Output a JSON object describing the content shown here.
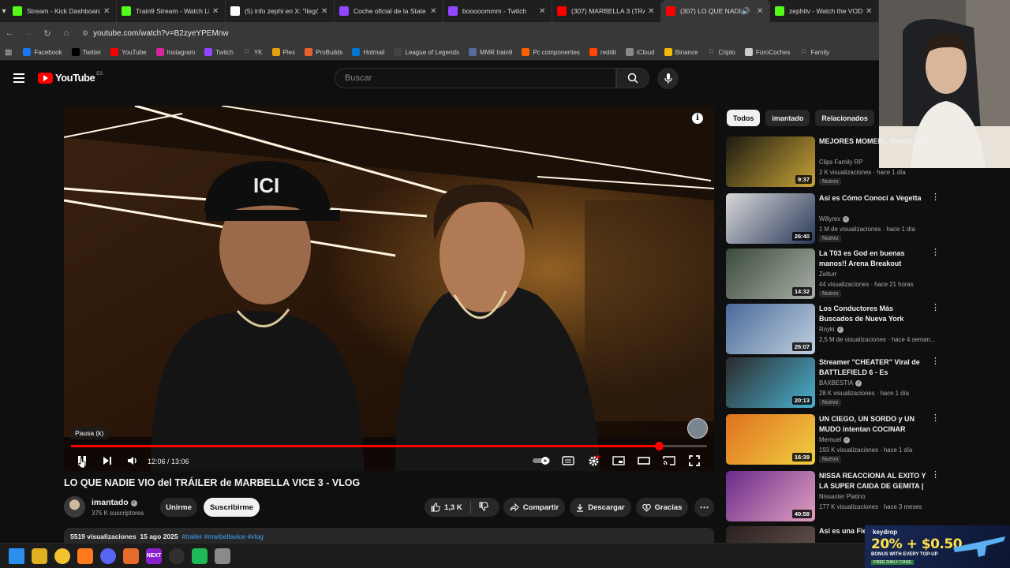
{
  "browser": {
    "tabs": [
      {
        "title": "Stream - Kick Dashboard",
        "favicon": "kick-icon",
        "color": "#53fc18"
      },
      {
        "title": "Train9 Stream - Watch Li...",
        "favicon": "kick-icon",
        "color": "#53fc18"
      },
      {
        "title": "(5) info zephi en X: \"llegó...",
        "favicon": "x-icon",
        "color": "#ffffff"
      },
      {
        "title": "Coche oficial de la State P...",
        "favicon": "twitch-icon",
        "color": "#9146ff"
      },
      {
        "title": "booooommm - Twitch",
        "favicon": "twitch-icon",
        "color": "#9146ff"
      },
      {
        "title": "(307) MARBELLA 3 (TRAI...",
        "favicon": "youtube-icon",
        "color": "#ff0000"
      },
      {
        "title": "(307) LO QUE NADIE",
        "favicon": "youtube-icon",
        "color": "#ff0000",
        "active": true
      },
      {
        "title": "zephitv - Watch the VOD",
        "favicon": "kick-icon",
        "color": "#53fc18"
      }
    ],
    "url": "youtube.com/watch?v=B2zyeYPEMnw",
    "bookmarks": [
      {
        "label": "Facebook",
        "icon": "facebook-icon",
        "color": "#1877f2"
      },
      {
        "label": "Twitter",
        "icon": "x-icon",
        "color": "#000000"
      },
      {
        "label": "YouTube",
        "icon": "youtube-icon",
        "color": "#ff0000"
      },
      {
        "label": "Instagram",
        "icon": "instagram-icon",
        "color": "#d6249f"
      },
      {
        "label": "Twitch",
        "icon": "twitch-icon",
        "color": "#9146ff"
      },
      {
        "label": "YK",
        "icon": "folder-icon",
        "color": "#383838"
      },
      {
        "label": "Plex",
        "icon": "plex-icon",
        "color": "#e5a00d"
      },
      {
        "label": "ProBuilds",
        "icon": "probuilds-icon",
        "color": "#e8612c"
      },
      {
        "label": "Hotmail",
        "icon": "outlook-icon",
        "color": "#0078d4"
      },
      {
        "label": "League of Legends",
        "icon": "lol-icon",
        "color": "#444444"
      },
      {
        "label": "MMR train9",
        "icon": "mmr-icon",
        "color": "#5a6a9a"
      },
      {
        "label": "Pc componentes",
        "icon": "pccomponentes-icon",
        "color": "#ff6000"
      },
      {
        "label": "reddit",
        "icon": "reddit-icon",
        "color": "#ff4500"
      },
      {
        "label": "iCloud",
        "icon": "apple-icon",
        "color": "#888888"
      },
      {
        "label": "Binance",
        "icon": "binance-icon",
        "color": "#f0b90b"
      },
      {
        "label": "Cripto",
        "icon": "folder-icon",
        "color": "#383838"
      },
      {
        "label": "ForoCoches",
        "icon": "forocoches-icon",
        "color": "#cccccc"
      },
      {
        "label": "Family",
        "icon": "folder-icon",
        "color": "#383838"
      }
    ]
  },
  "youtube": {
    "logo_word": "YouTube",
    "country": "ES",
    "search_placeholder": "Buscar"
  },
  "player": {
    "tooltip": "Pausa (k)",
    "time_display": "12:06 / 13:06",
    "progress": 0.9237
  },
  "video": {
    "title": "LO QUE NADIE VIO del TRÁILER de MARBELLA VICE 3 - VLOG",
    "channel": "imantado",
    "subscribers": "375 K suscriptores",
    "join_label": "Unirme",
    "subscribe_label": "Suscribirme",
    "likes": "1,3 K",
    "share_label": "Compartir",
    "download_label": "Descargar",
    "thanks_label": "Gracias",
    "views": "5519 visualizaciones",
    "date": "15 ago 2025",
    "tags": "#trailer #marbellavice #vlog"
  },
  "sidebar": {
    "chips": [
      "Todos",
      "imantado",
      "Relacionados"
    ],
    "recommendations": [
      {
        "title": "MEJORES MOMEN... Family RP",
        "channel": "Clips Family RP",
        "meta": "2 K visualizaciones · hace 1 día",
        "badge": "Nuevo",
        "duration": "9:37",
        "verified": false,
        "thumb": [
          "#1a1a10",
          "#c9a338"
        ]
      },
      {
        "title": "Así es Cómo Conocí a Vegetta",
        "channel": "Willyrex",
        "meta": "1 M de visualizaciones · hace 1 día",
        "badge": "Nuevo",
        "duration": "26:40",
        "verified": true,
        "thumb": [
          "#d8d8d8",
          "#2a3a5a"
        ]
      },
      {
        "title": "La T03 es God en buenas manos!! Arena Breakout Infinit...",
        "channel": "Zelturr",
        "meta": "44 visualizaciones · hace 21 horas",
        "badge": "Nuevo",
        "duration": "14:32",
        "verified": false,
        "thumb": [
          "#3a4a3a",
          "#aab0a8"
        ]
      },
      {
        "title": "Los Conductores Más Buscados de Nueva York",
        "channel": "Royki",
        "meta": "2,5 M de visualizaciones · hace 4 seman...",
        "badge": "",
        "duration": "26:07",
        "verified": true,
        "thumb": [
          "#4a6a9a",
          "#c0d0e0"
        ]
      },
      {
        "title": "Streamer \"CHEATER\" Viral de BATTLEFIELD 6 - Es realmente...",
        "channel": "BAXBESTIA",
        "meta": "28 K visualizaciones · hace 1 día",
        "badge": "Nuevo",
        "duration": "20:13",
        "verified": true,
        "thumb": [
          "#2a2a2a",
          "#4ab0d0"
        ]
      },
      {
        "title": "UN CIEGO, UN SORDO y UN MUDO intentan COCINAR",
        "channel": "Mernuel",
        "meta": "193 K visualizaciones · hace 1 día",
        "badge": "Nuevo",
        "duration": "16:39",
        "verified": true,
        "thumb": [
          "#e07020",
          "#f0d040"
        ]
      },
      {
        "title": "NISSA REACCIONA AL EXITO Y LA SUPER CAIDA DE GEMITA | ...",
        "channel": "Nissaxter Platino",
        "meta": "177 K visualizaciones · hace 3 meses",
        "badge": "",
        "duration": "40:58",
        "verified": false,
        "thumb": [
          "#6a2a8a",
          "#e0a0c0"
        ]
      },
      {
        "title": "Así es una Fie... Influencers",
        "channel": "",
        "meta": "",
        "badge": "",
        "duration": "",
        "verified": false,
        "thumb": [
          "#2a2020",
          "#6a5a50"
        ]
      }
    ]
  },
  "ad": {
    "brand": "keydrop",
    "headline": "20% + $0.50",
    "sub": "BONUS WITH EVERY TOP-UP",
    "tag": "FREE DAILY CASE"
  },
  "taskbar": [
    {
      "name": "windows-start-icon",
      "color": "#2b8ff0",
      "label": ""
    },
    {
      "name": "chrome-icon",
      "color": "#e0b020",
      "label": ""
    },
    {
      "name": "file-explorer-icon",
      "color": "#f2c230",
      "label": ""
    },
    {
      "name": "firefox-icon",
      "color": "#ff7a1a",
      "label": ""
    },
    {
      "name": "discord-icon",
      "color": "#5865f2",
      "label": ""
    },
    {
      "name": "app-icon",
      "color": "#e66a2a",
      "label": ""
    },
    {
      "name": "next-icon",
      "color": "#8a1fd0",
      "label": "NEXT"
    },
    {
      "name": "obs-icon",
      "color": "#303030",
      "label": ""
    },
    {
      "name": "spotify-icon",
      "color": "#1db954",
      "label": ""
    },
    {
      "name": "settings-icon",
      "color": "#8a8a8a",
      "label": ""
    }
  ]
}
